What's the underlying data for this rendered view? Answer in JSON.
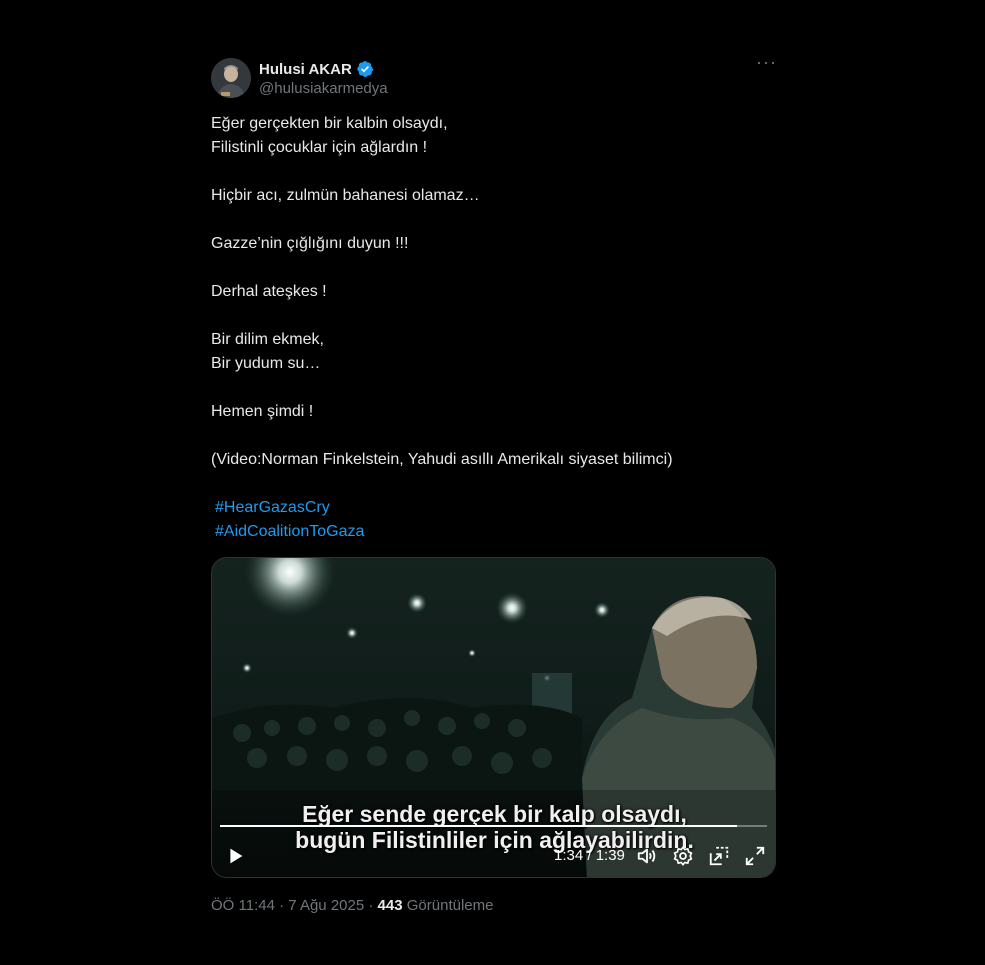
{
  "author": {
    "display_name": "Hulusi AKAR",
    "handle": "@hulusiakarmedya",
    "verified": true
  },
  "tweet": {
    "lines": [
      "Eğer gerçekten bir kalbin olsaydı,",
      "Filistinli çocuklar için ağlardın !",
      "",
      "Hiçbir acı, zulmün bahanesi olamaz…",
      "",
      "Gazze’nin çığlığını duyun !!!",
      "",
      "Derhal ateşkes !",
      "",
      "Bir dilim ekmek,",
      "Bir yudum su…",
      "",
      "Hemen şimdi !",
      "",
      "(Video:Norman Finkelstein, Yahudi asıllı Amerikalı siyaset bilimci)",
      ""
    ],
    "hashtags": [
      "#HearGazasCry",
      "#AidCoalitionToGaza"
    ]
  },
  "video": {
    "subtitle_line1": "Eğer sende gerçek bir kalp olsaydı,",
    "subtitle_line2": "bugün Filistinliler için ağlayabilirdin.",
    "time_display": "1:34 / 1:39",
    "progress_fraction": 0.946,
    "icons": [
      "play-icon",
      "volume-icon",
      "settings-icon",
      "dock-icon",
      "fullscreen-icon"
    ]
  },
  "meta": {
    "time": "ÖÖ 11:44",
    "separator": "·",
    "date": "7 Ağu 2025",
    "views_count": "443",
    "views_label": "Görüntüleme"
  },
  "colors": {
    "background": "#000000",
    "text": "#e7e9ea",
    "secondary": "#71767b",
    "link": "#1d9bf0",
    "verified_badge": "#1d9bf0"
  }
}
